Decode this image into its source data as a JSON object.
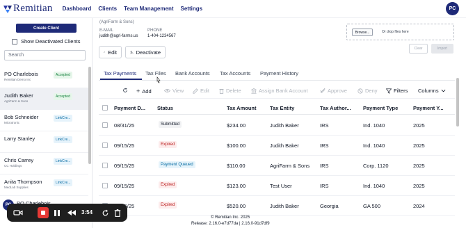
{
  "app": {
    "brand": "Remitian",
    "nav": [
      "Dashboard",
      "Clients",
      "Team Management",
      "Settings"
    ],
    "user_initials": "PC"
  },
  "sidebar": {
    "create_label": "Create Client",
    "show_deactivated_label": "Show Deactivated Clients",
    "search_placeholder": "Search",
    "clients": [
      {
        "name": "PO Charlebois",
        "sub": "Remitian Demo Inc",
        "badge": "Accepted"
      },
      {
        "name": "Judith Baker",
        "sub": "AgriFarm & Sons",
        "badge": "Accepted"
      },
      {
        "name": "Bob Schneider",
        "sub": "Microtronic",
        "badge": "LinkCre..."
      },
      {
        "name": "Larry Stanley",
        "sub": "",
        "badge": "LinkCre..."
      },
      {
        "name": "Chris Carrey",
        "sub": "CC Holdings",
        "badge": "LinkCre..."
      },
      {
        "name": "Anita Thompson",
        "sub": "MedLab Supplies",
        "badge": "LinkCre..."
      }
    ],
    "bottom_client": {
      "name": "PO Charlebois",
      "sub": "Remitian Demo Inc",
      "initials": "PC"
    }
  },
  "client": {
    "company": "(AgriFarm & Sons)",
    "email_label": "E-MAIL",
    "email": "judith@agri-farms.us",
    "phone_label": "PHONE",
    "phone": "1-404-1234567",
    "edit_label": "Edit",
    "deactivate_label": "Deactivate"
  },
  "upload": {
    "browse_label": "Browse...",
    "drop_label": "Or drop files here",
    "clear_label": "Clear",
    "import_label": "Import"
  },
  "tabs": [
    "Tax Payments",
    "Tax Files",
    "Bank Accounts",
    "Tax Accounts",
    "Payment History"
  ],
  "toolbar": {
    "add": "Add",
    "view": "View",
    "edit": "Edit",
    "delete": "Delete",
    "assign": "Assign Bank Account",
    "approve": "Approve",
    "deny": "Deny",
    "filters": "Filters",
    "columns": "Columns"
  },
  "table": {
    "headers": [
      "Payment D...",
      "Status",
      "Tax Amount",
      "Tax Entity",
      "Tax Author...",
      "Payment Type",
      "Payment Y..."
    ],
    "rows": [
      {
        "date": "08/31/25",
        "status": "Submitted",
        "amount": "$234.00",
        "entity": "Judith Baker",
        "authority": "IRS",
        "type": "Ind. 1040",
        "year": "2025"
      },
      {
        "date": "09/15/25",
        "status": "Expired",
        "amount": "$100.00",
        "entity": "Judith Baker",
        "authority": "IRS",
        "type": "Ind. 1040",
        "year": "2025"
      },
      {
        "date": "09/15/25",
        "status": "Payment Queued",
        "amount": "$110.00",
        "entity": "AgriFarm & Sons",
        "authority": "IRS",
        "type": "Corp. 1120",
        "year": "2025"
      },
      {
        "date": "09/15/25",
        "status": "Expired",
        "amount": "$123.00",
        "entity": "Test User",
        "authority": "IRS",
        "type": "Ind. 1040",
        "year": "2025"
      },
      {
        "date": "09/15/25",
        "status": "Expired",
        "amount": "$520.00",
        "entity": "Judith Baker",
        "authority": "Georgia",
        "type": "GA 500",
        "year": "2024"
      }
    ]
  },
  "footer": {
    "copyright": "© Remitian Inc. 2025",
    "release": "Release: 2.16.0-e7d77da | 2.16.0-91d7df9"
  },
  "recorder": {
    "time": "3:54"
  },
  "colors": {
    "brand": "#1e2a78",
    "accepted_bg": "#e6f6ea",
    "expired_bg": "#fdecec",
    "queued_bg": "#e6f4fb"
  }
}
